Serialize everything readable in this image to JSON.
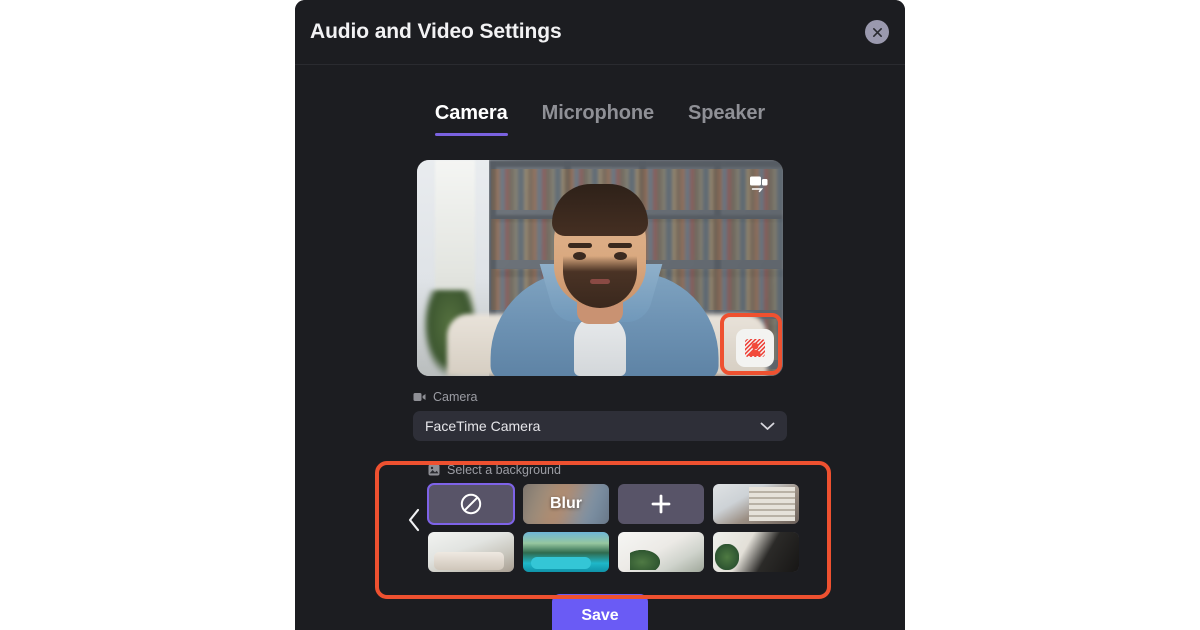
{
  "modal": {
    "title": "Audio and Video Settings",
    "close_icon": "close-icon"
  },
  "tabs": [
    {
      "label": "Camera",
      "active": true
    },
    {
      "label": "Microphone",
      "active": false
    },
    {
      "label": "Speaker",
      "active": false
    }
  ],
  "preview": {
    "flip_icon": "screen-share-icon",
    "background_effects_icon": "background-effects-icon"
  },
  "camera_field": {
    "label": "Camera",
    "label_icon": "video-camera-icon",
    "selected_value": "FaceTime Camera",
    "chevron_icon": "chevron-down-icon"
  },
  "background_section": {
    "label": "Select a background",
    "label_icon": "image-icon",
    "prev_arrow_icon": "chevron-left-icon",
    "thumbnails": [
      {
        "name": "none",
        "label": "",
        "icon": "no-background-icon",
        "selected": true,
        "kind": "icon"
      },
      {
        "name": "blur",
        "label": "Blur",
        "icon": "",
        "selected": false,
        "kind": "blur"
      },
      {
        "name": "add",
        "label": "",
        "icon": "plus-icon",
        "selected": false,
        "kind": "icon"
      },
      {
        "name": "home-office",
        "label": "",
        "icon": "",
        "selected": false,
        "kind": "scene",
        "scene": "sc1"
      },
      {
        "name": "living-room",
        "label": "",
        "icon": "",
        "selected": false,
        "kind": "scene",
        "scene": "sc2"
      },
      {
        "name": "poolside",
        "label": "",
        "icon": "",
        "selected": false,
        "kind": "scene",
        "scene": "sc3"
      },
      {
        "name": "bedroom",
        "label": "",
        "icon": "",
        "selected": false,
        "kind": "scene",
        "scene": "sc4"
      },
      {
        "name": "lounge",
        "label": "",
        "icon": "",
        "selected": false,
        "kind": "scene",
        "scene": "sc5"
      }
    ]
  },
  "footer": {
    "save_label": "Save"
  },
  "colors": {
    "accent_purple": "#6a5bf5",
    "tab_underline": "#7a62e0",
    "annotation_red": "#ee5130",
    "modal_background": "#1c1d21",
    "select_background": "#2e2f38",
    "thumb_placeholder": "#585468",
    "page_background": "#ffffff"
  }
}
